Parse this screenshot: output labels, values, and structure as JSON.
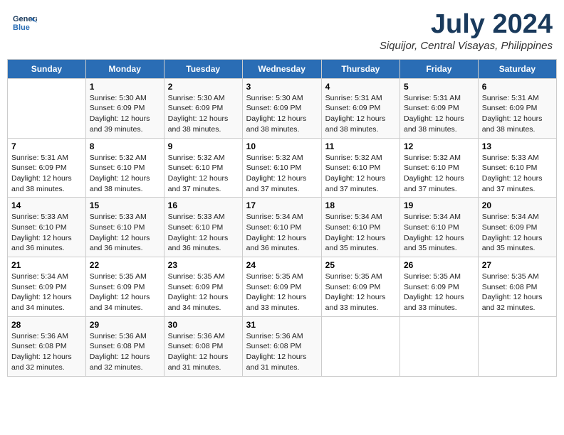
{
  "logo": {
    "line1": "General",
    "line2": "Blue"
  },
  "title": "July 2024",
  "location": "Siquijor, Central Visayas, Philippines",
  "days_of_week": [
    "Sunday",
    "Monday",
    "Tuesday",
    "Wednesday",
    "Thursday",
    "Friday",
    "Saturday"
  ],
  "weeks": [
    [
      {
        "day": "",
        "info": ""
      },
      {
        "day": "1",
        "info": "Sunrise: 5:30 AM\nSunset: 6:09 PM\nDaylight: 12 hours\nand 39 minutes."
      },
      {
        "day": "2",
        "info": "Sunrise: 5:30 AM\nSunset: 6:09 PM\nDaylight: 12 hours\nand 38 minutes."
      },
      {
        "day": "3",
        "info": "Sunrise: 5:30 AM\nSunset: 6:09 PM\nDaylight: 12 hours\nand 38 minutes."
      },
      {
        "day": "4",
        "info": "Sunrise: 5:31 AM\nSunset: 6:09 PM\nDaylight: 12 hours\nand 38 minutes."
      },
      {
        "day": "5",
        "info": "Sunrise: 5:31 AM\nSunset: 6:09 PM\nDaylight: 12 hours\nand 38 minutes."
      },
      {
        "day": "6",
        "info": "Sunrise: 5:31 AM\nSunset: 6:09 PM\nDaylight: 12 hours\nand 38 minutes."
      }
    ],
    [
      {
        "day": "7",
        "info": "Sunrise: 5:31 AM\nSunset: 6:09 PM\nDaylight: 12 hours\nand 38 minutes."
      },
      {
        "day": "8",
        "info": "Sunrise: 5:32 AM\nSunset: 6:10 PM\nDaylight: 12 hours\nand 38 minutes."
      },
      {
        "day": "9",
        "info": "Sunrise: 5:32 AM\nSunset: 6:10 PM\nDaylight: 12 hours\nand 37 minutes."
      },
      {
        "day": "10",
        "info": "Sunrise: 5:32 AM\nSunset: 6:10 PM\nDaylight: 12 hours\nand 37 minutes."
      },
      {
        "day": "11",
        "info": "Sunrise: 5:32 AM\nSunset: 6:10 PM\nDaylight: 12 hours\nand 37 minutes."
      },
      {
        "day": "12",
        "info": "Sunrise: 5:32 AM\nSunset: 6:10 PM\nDaylight: 12 hours\nand 37 minutes."
      },
      {
        "day": "13",
        "info": "Sunrise: 5:33 AM\nSunset: 6:10 PM\nDaylight: 12 hours\nand 37 minutes."
      }
    ],
    [
      {
        "day": "14",
        "info": "Sunrise: 5:33 AM\nSunset: 6:10 PM\nDaylight: 12 hours\nand 36 minutes."
      },
      {
        "day": "15",
        "info": "Sunrise: 5:33 AM\nSunset: 6:10 PM\nDaylight: 12 hours\nand 36 minutes."
      },
      {
        "day": "16",
        "info": "Sunrise: 5:33 AM\nSunset: 6:10 PM\nDaylight: 12 hours\nand 36 minutes."
      },
      {
        "day": "17",
        "info": "Sunrise: 5:34 AM\nSunset: 6:10 PM\nDaylight: 12 hours\nand 36 minutes."
      },
      {
        "day": "18",
        "info": "Sunrise: 5:34 AM\nSunset: 6:10 PM\nDaylight: 12 hours\nand 35 minutes."
      },
      {
        "day": "19",
        "info": "Sunrise: 5:34 AM\nSunset: 6:10 PM\nDaylight: 12 hours\nand 35 minutes."
      },
      {
        "day": "20",
        "info": "Sunrise: 5:34 AM\nSunset: 6:09 PM\nDaylight: 12 hours\nand 35 minutes."
      }
    ],
    [
      {
        "day": "21",
        "info": "Sunrise: 5:34 AM\nSunset: 6:09 PM\nDaylight: 12 hours\nand 34 minutes."
      },
      {
        "day": "22",
        "info": "Sunrise: 5:35 AM\nSunset: 6:09 PM\nDaylight: 12 hours\nand 34 minutes."
      },
      {
        "day": "23",
        "info": "Sunrise: 5:35 AM\nSunset: 6:09 PM\nDaylight: 12 hours\nand 34 minutes."
      },
      {
        "day": "24",
        "info": "Sunrise: 5:35 AM\nSunset: 6:09 PM\nDaylight: 12 hours\nand 33 minutes."
      },
      {
        "day": "25",
        "info": "Sunrise: 5:35 AM\nSunset: 6:09 PM\nDaylight: 12 hours\nand 33 minutes."
      },
      {
        "day": "26",
        "info": "Sunrise: 5:35 AM\nSunset: 6:09 PM\nDaylight: 12 hours\nand 33 minutes."
      },
      {
        "day": "27",
        "info": "Sunrise: 5:35 AM\nSunset: 6:08 PM\nDaylight: 12 hours\nand 32 minutes."
      }
    ],
    [
      {
        "day": "28",
        "info": "Sunrise: 5:36 AM\nSunset: 6:08 PM\nDaylight: 12 hours\nand 32 minutes."
      },
      {
        "day": "29",
        "info": "Sunrise: 5:36 AM\nSunset: 6:08 PM\nDaylight: 12 hours\nand 32 minutes."
      },
      {
        "day": "30",
        "info": "Sunrise: 5:36 AM\nSunset: 6:08 PM\nDaylight: 12 hours\nand 31 minutes."
      },
      {
        "day": "31",
        "info": "Sunrise: 5:36 AM\nSunset: 6:08 PM\nDaylight: 12 hours\nand 31 minutes."
      },
      {
        "day": "",
        "info": ""
      },
      {
        "day": "",
        "info": ""
      },
      {
        "day": "",
        "info": ""
      }
    ]
  ]
}
